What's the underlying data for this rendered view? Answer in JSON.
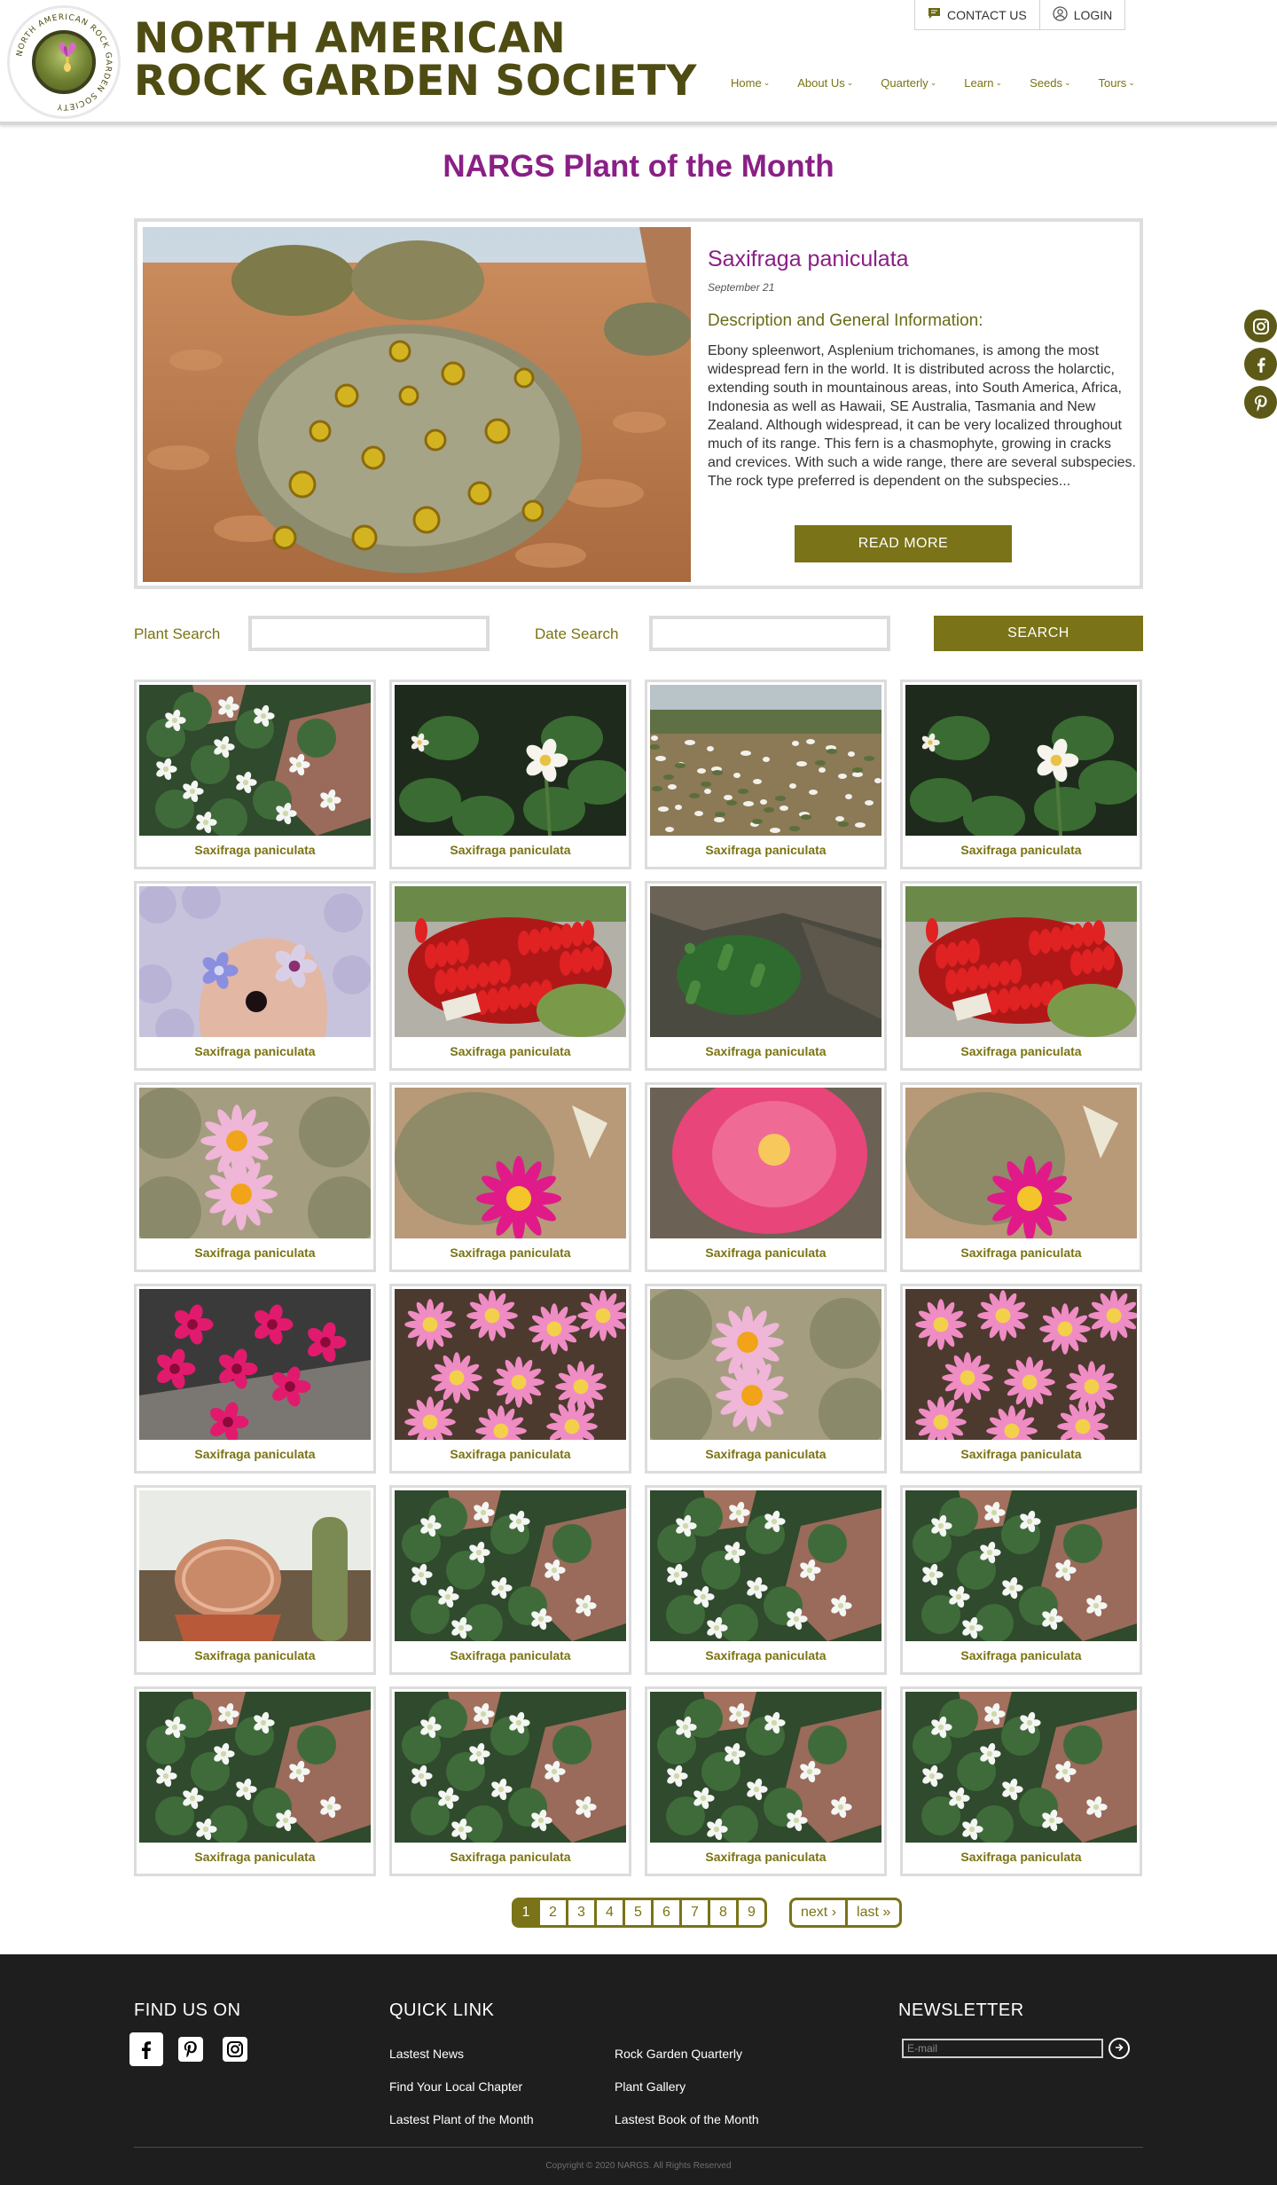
{
  "header": {
    "title_line1": "NORTH AMERICAN",
    "title_line2": "ROCK GARDEN SOCIETY",
    "logo_text": "NORTH AMERICAN ROCK GARDEN SOCIETY",
    "contact_label": "CONTACT US",
    "login_label": "LOGIN",
    "nav": [
      {
        "label": "Home"
      },
      {
        "label": "About Us"
      },
      {
        "label": "Quarterly"
      },
      {
        "label": "Learn"
      },
      {
        "label": "Seeds"
      },
      {
        "label": "Tours"
      }
    ]
  },
  "page": {
    "title": "NARGS Plant of the Month"
  },
  "featured": {
    "name": "Saxifraga paniculata",
    "date": "September 21",
    "subheading": "Description and General Information:",
    "description": "Ebony spleenwort, Asplenium trichomanes, is among the most widespread fern in the world.  It is distributed across the holarctic, extending south in mountainous areas, into South America, Africa, Indonesia as well as Hawaii, SE Australia, Tasmania and New Zealand.  Although widespread, it can be very localized throughout much of its range.  This fern is a chasmophyte, growing in cracks and crevices.  With such a wide range, there are several subspecies.  The rock type preferred is dependent on the subspecies...",
    "read_more": "READ MORE"
  },
  "search": {
    "plant_label": "Plant Search",
    "date_label": "Date Search",
    "plant_value": "",
    "date_value": "",
    "button": "SEARCH"
  },
  "grid": [
    {
      "label": "Saxifraga paniculata",
      "img": "white-flowers"
    },
    {
      "label": "Saxifraga paniculata",
      "img": "white-single"
    },
    {
      "label": "Saxifraga paniculata",
      "img": "meadow"
    },
    {
      "label": "Saxifraga paniculata",
      "img": "white-single"
    },
    {
      "label": "Saxifraga paniculata",
      "img": "blue-hand"
    },
    {
      "label": "Saxifraga paniculata",
      "img": "red-bush"
    },
    {
      "label": "Saxifraga paniculata",
      "img": "green-rock"
    },
    {
      "label": "Saxifraga paniculata",
      "img": "red-bush"
    },
    {
      "label": "Saxifraga paniculata",
      "img": "pink-cactus-light"
    },
    {
      "label": "Saxifraga paniculata",
      "img": "magenta-cactus"
    },
    {
      "label": "Saxifraga paniculata",
      "img": "pink-cup"
    },
    {
      "label": "Saxifraga paniculata",
      "img": "magenta-cactus"
    },
    {
      "label": "Saxifraga paniculata",
      "img": "magenta-cluster"
    },
    {
      "label": "Saxifraga paniculata",
      "img": "pink-daisies"
    },
    {
      "label": "Saxifraga paniculata",
      "img": "pink-cactus-light"
    },
    {
      "label": "Saxifraga paniculata",
      "img": "pink-daisies"
    },
    {
      "label": "Saxifraga paniculata",
      "img": "cactus-pots"
    },
    {
      "label": "Saxifraga paniculata",
      "img": "white-flowers"
    },
    {
      "label": "Saxifraga paniculata",
      "img": "white-flowers"
    },
    {
      "label": "Saxifraga paniculata",
      "img": "white-flowers"
    },
    {
      "label": "Saxifraga paniculata",
      "img": "white-flowers"
    },
    {
      "label": "Saxifraga paniculata",
      "img": "white-flowers"
    },
    {
      "label": "Saxifraga paniculata",
      "img": "white-flowers"
    },
    {
      "label": "Saxifraga paniculata",
      "img": "white-flowers"
    }
  ],
  "pagination": {
    "pages": [
      "1",
      "2",
      "3",
      "4",
      "5",
      "6",
      "7",
      "8",
      "9"
    ],
    "current": "1",
    "next": "next ›",
    "last": "last »"
  },
  "side_social": [
    {
      "icon": "instagram-icon"
    },
    {
      "icon": "facebook-icon"
    },
    {
      "icon": "pinterest-icon"
    }
  ],
  "footer": {
    "find_us": "FIND US ON",
    "quick_link": "QUICK LINK",
    "newsletter": "NEWSLETTER",
    "email_placeholder": "E-mail",
    "links_col1": [
      "Lastest News",
      "Find Your Local Chapter",
      "Lastest Plant of the Month"
    ],
    "links_col2": [
      "Rock Garden Quarterly",
      "Plant Gallery",
      "Lastest Book of the Month"
    ],
    "copyright": "Copyright © 2020 NARGS. All Rights Reserved"
  },
  "colors": {
    "brand_olive": "#7a7318",
    "title_dark_olive": "#4e4c12",
    "accent_purple": "#8a1f86",
    "footer_bg": "#1e1e1e"
  }
}
